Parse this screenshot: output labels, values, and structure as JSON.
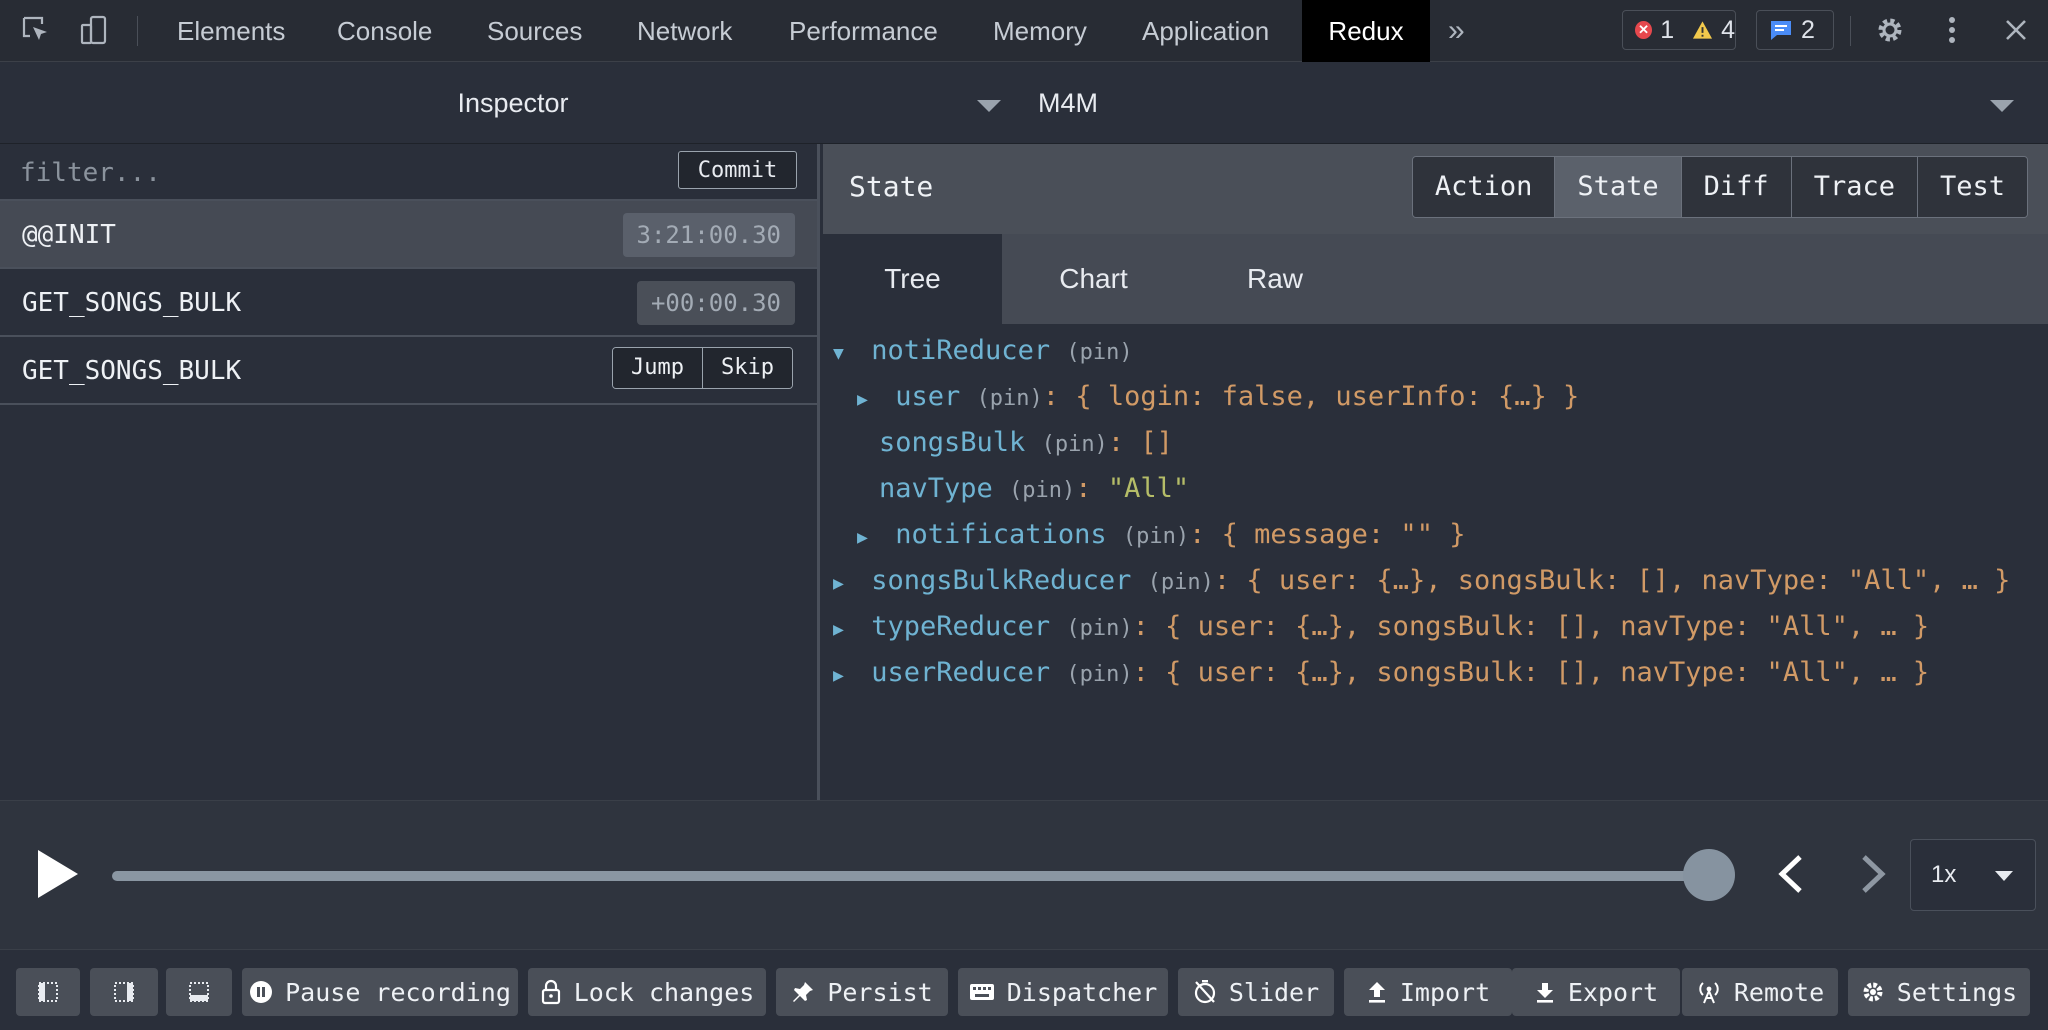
{
  "devtools": {
    "tabs": [
      "Elements",
      "Console",
      "Sources",
      "Network",
      "Performance",
      "Memory",
      "Application",
      "Redux"
    ],
    "active_tab": "Redux",
    "more_tabs": "»",
    "errors": "1",
    "warnings": "4",
    "messages": "2"
  },
  "header": {
    "left_monitor": "Inspector",
    "right_monitor": "M4M"
  },
  "actions": {
    "filter_placeholder": "filter...",
    "commit_label": "Commit",
    "items": [
      {
        "name": "@@INIT",
        "time": "3:21:00.30"
      },
      {
        "name": "GET_SONGS_BULK",
        "time": "+00:00.30"
      },
      {
        "name": "GET_SONGS_BULK",
        "jump": "Jump",
        "skip": "Skip"
      }
    ]
  },
  "panel": {
    "title": "State",
    "modes": [
      "Action",
      "State",
      "Diff",
      "Trace",
      "Test"
    ],
    "active_mode": "State",
    "subtabs": [
      "Tree",
      "Chart",
      "Raw"
    ],
    "active_subtab": "Tree"
  },
  "tree": {
    "pin": "(pin)",
    "root": "notiReducer",
    "user_key": "user",
    "user_value": "{ login: false, userInfo: {…} }",
    "songs_key": "songsBulk",
    "songs_value": "[]",
    "nav_key": "navType",
    "nav_value": "\"All\"",
    "notif_key": "notifications",
    "notif_value": "{ message: \"\" }",
    "r2_key": "songsBulkReducer",
    "r2_value": "{ user: {…}, songsBulk: [], navType: \"All\", … }",
    "r3_key": "typeReducer",
    "r3_value": "{ user: {…}, songsBulk: [], navType: \"All\", … }",
    "r4_key": "userReducer",
    "r4_value": "{ user: {…}, songsBulk: [], navType: \"All\", … }"
  },
  "slider": {
    "speed": "1x",
    "position": 1.0
  },
  "toolbar": {
    "pause": "Pause recording",
    "lock": "Lock changes",
    "persist": "Persist",
    "dispatcher": "Dispatcher",
    "slider": "Slider",
    "import": "Import",
    "export": "Export",
    "remote": "Remote",
    "settings": "Settings"
  }
}
